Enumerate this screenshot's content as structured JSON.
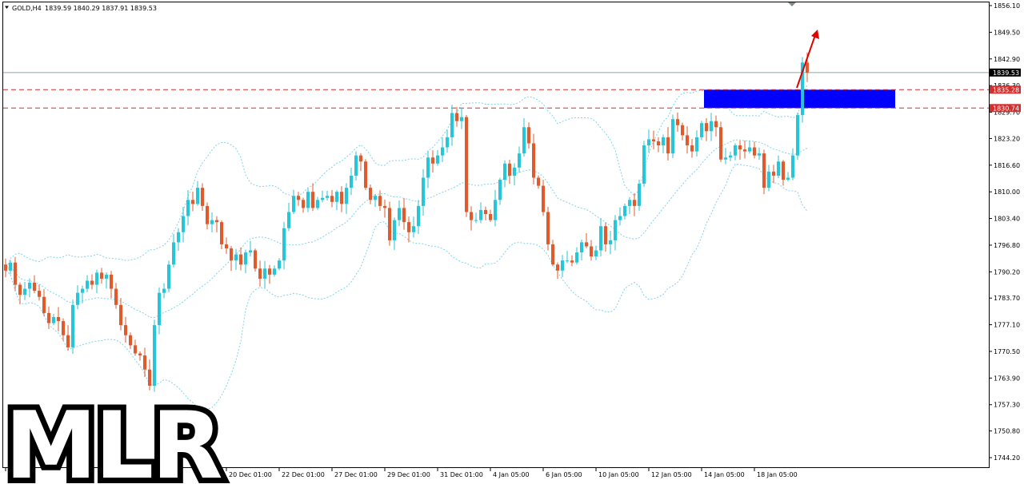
{
  "header": {
    "symbol": "GOLD,H4",
    "ohlc": "1839.59 1840.29 1837.91 1839.53"
  },
  "watermark": "MLR",
  "colors": {
    "bull": "#26c6da",
    "bear": "#e2592b",
    "band": "#7fd3ea",
    "zone": "#0000ff",
    "level": "#d32f2f",
    "arrow": "#e00000",
    "price_line": "#90a4ae",
    "text": "#000000"
  },
  "price_axis": {
    "ticks": [
      "1856.10",
      "1849.50",
      "1842.90",
      "1836.30",
      "1829.70",
      "1823.20",
      "1816.60",
      "1810.00",
      "1803.40",
      "1796.80",
      "1790.20",
      "1783.70",
      "1777.10",
      "1770.50",
      "1763.90",
      "1757.30",
      "1750.80",
      "1744.20"
    ],
    "current_price_label": "1839.53",
    "level_labels": [
      "1835.28",
      "1830.74"
    ]
  },
  "chart_data": {
    "type": "candlestick",
    "symbol": "GOLD",
    "timeframe": "H4",
    "ylim": [
      1741.6,
      1857.2
    ],
    "x_tick_labels": [
      {
        "label": "8",
        "index": 0
      },
      {
        "label": "20 Dec 01:00",
        "index": 46
      },
      {
        "label": "22 Dec 01:00",
        "index": 57
      },
      {
        "label": "27 Dec 01:00",
        "index": 68
      },
      {
        "label": "29 Dec 01:00",
        "index": 79
      },
      {
        "label": "31 Dec 01:00",
        "index": 90
      },
      {
        "label": "4 Jan 05:00",
        "index": 101
      },
      {
        "label": "6 Jan 05:00",
        "index": 112
      },
      {
        "label": "10 Jan 05:00",
        "index": 123
      },
      {
        "label": "12 Jan 05:00",
        "index": 134
      },
      {
        "label": "14 Jan 05:00",
        "index": 145
      },
      {
        "label": "18 Jan 05:00",
        "index": 156
      }
    ],
    "close": [
      1790.5,
      1792.5,
      1787.0,
      1784.5,
      1786.0,
      1787.5,
      1785.5,
      1784.0,
      1780.0,
      1777.5,
      1779.0,
      1778.0,
      1774.5,
      1771.5,
      1782.0,
      1785.0,
      1786.0,
      1788.0,
      1787.0,
      1790.0,
      1788.5,
      1789.5,
      1786.0,
      1782.0,
      1777.0,
      1774.5,
      1772.0,
      1770.0,
      1769.5,
      1766.0,
      1762.0,
      1777.0,
      1785.0,
      1786.0,
      1792.0,
      1797.5,
      1800.0,
      1804.0,
      1808.0,
      1807.0,
      1811.0,
      1806.5,
      1802.0,
      1803.0,
      1802.5,
      1797.0,
      1796.0,
      1793.0,
      1794.5,
      1792.0,
      1795.0,
      1795.5,
      1791.0,
      1788.5,
      1791.0,
      1789.5,
      1791.0,
      1793.0,
      1801.0,
      1805.0,
      1809.0,
      1808.0,
      1806.0,
      1810.0,
      1806.0,
      1808.0,
      1808.5,
      1809.0,
      1807.5,
      1810.0,
      1807.0,
      1811.0,
      1814.0,
      1819.0,
      1817.5,
      1811.0,
      1808.0,
      1809.0,
      1806.5,
      1806.0,
      1798.0,
      1803.0,
      1806.0,
      1802.5,
      1800.0,
      1801.5,
      1806.5,
      1813.5,
      1818.5,
      1817.0,
      1819.0,
      1821.0,
      1823.5,
      1829.5,
      1827.5,
      1828.5,
      1805.0,
      1803.0,
      1803.0,
      1805.5,
      1804.5,
      1803.0,
      1808.0,
      1813.0,
      1817.0,
      1814.0,
      1816.0,
      1819.5,
      1826.0,
      1822.0,
      1813.5,
      1811.5,
      1805.0,
      1797.0,
      1792.0,
      1790.5,
      1793.0,
      1793.0,
      1792.5,
      1795.0,
      1797.5,
      1796.5,
      1794.0,
      1795.5,
      1801.5,
      1797.0,
      1798.0,
      1803.0,
      1804.0,
      1806.5,
      1808.0,
      1806.5,
      1812.0,
      1821.5,
      1823.0,
      1822.5,
      1821.5,
      1823.5,
      1819.5,
      1828.0,
      1826.5,
      1824.0,
      1821.5,
      1820.0,
      1823.5,
      1827.0,
      1825.0,
      1827.5,
      1826.0,
      1818.0,
      1818.5,
      1819.0,
      1821.5,
      1820.5,
      1820.0,
      1821.0,
      1819.0,
      1819.5,
      1811.0,
      1815.0,
      1814.0,
      1817.5,
      1813.0,
      1813.5,
      1819.0,
      1829.0,
      1842.0,
      1839.53
    ]
  }
}
